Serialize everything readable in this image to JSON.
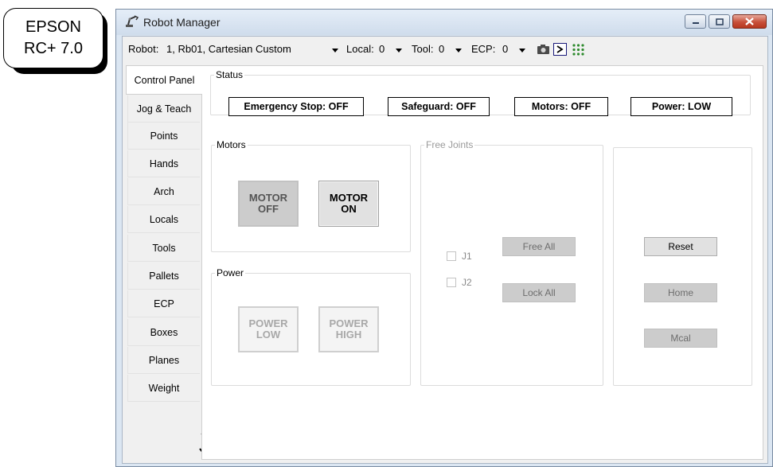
{
  "badge": {
    "line1": "EPSON",
    "line2": "RC+ 7.0"
  },
  "window": {
    "title": "Robot Manager",
    "icon": "robot-arm-icon"
  },
  "toolbar": {
    "robot_label": "Robot:",
    "robot_value": "1, Rb01, Cartesian Custom",
    "local_label": "Local:",
    "local_value": "0",
    "tool_label": "Tool:",
    "tool_value": "0",
    "ecp_label": "ECP:",
    "ecp_value": "0",
    "icons": [
      "camera-icon",
      "terminal-icon",
      "dots-grid-icon"
    ]
  },
  "tabs": [
    {
      "label": "Control Panel"
    },
    {
      "label": "Jog & Teach"
    },
    {
      "label": "Points"
    },
    {
      "label": "Hands"
    },
    {
      "label": "Arch"
    },
    {
      "label": "Locals"
    },
    {
      "label": "Tools"
    },
    {
      "label": "Pallets"
    },
    {
      "label": "ECP"
    },
    {
      "label": "Boxes"
    },
    {
      "label": "Planes"
    },
    {
      "label": "Weight"
    }
  ],
  "status": {
    "legend": "Status",
    "emergency": "Emergency Stop: OFF",
    "safeguard": "Safeguard: OFF",
    "motors": "Motors: OFF",
    "power": "Power: LOW"
  },
  "motors": {
    "legend": "Motors",
    "off_line1": "MOTOR",
    "off_line2": "OFF",
    "on_line1": "MOTOR",
    "on_line2": "ON"
  },
  "power": {
    "legend": "Power",
    "low_line1": "POWER",
    "low_line2": "LOW",
    "high_line1": "POWER",
    "high_line2": "HIGH"
  },
  "free_joints": {
    "legend": "Free Joints",
    "j1": "J1",
    "j2": "J2",
    "free_all": "Free All",
    "lock_all": "Lock All"
  },
  "actions": {
    "reset": "Reset",
    "home": "Home",
    "mcal": "Mcal"
  },
  "colors": {
    "accent_close": "#c7503a",
    "titlebar": "#dbe6f2"
  }
}
